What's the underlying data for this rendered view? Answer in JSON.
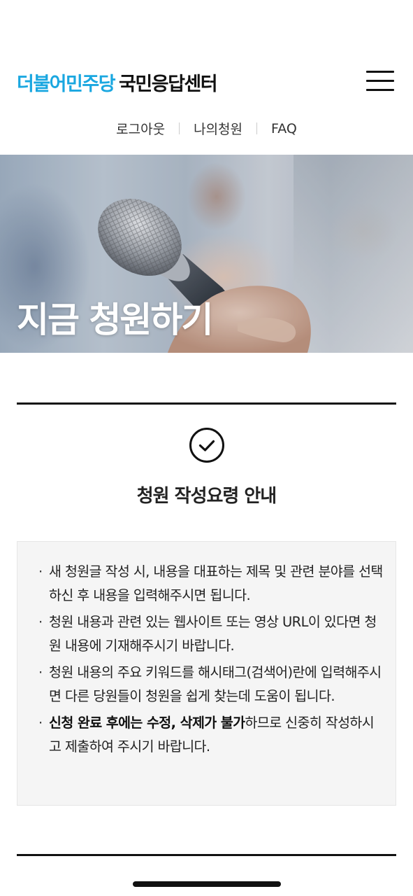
{
  "header": {
    "logo_party": "더불어민주당",
    "logo_center": "국민응답센터",
    "menu_icon": "hamburger-menu-icon"
  },
  "util_nav": {
    "logout": "로그아웃",
    "my_petitions": "나의청원",
    "faq": "FAQ"
  },
  "hero": {
    "title": "지금 청원하기",
    "image": "microphone-photo"
  },
  "guide": {
    "icon": "check-circle-icon",
    "title": "청원 작성요령 안내",
    "items": [
      {
        "text": "새 청원글 작성 시, 내용을 대표하는 제목 및 관련 분야를 선택하신 후 내용을 입력해주시면 됩니다."
      },
      {
        "text": "청원 내용과 관련 있는 웹사이트 또는 영상 URL이 있다면 청원 내용에 기재해주시기 바랍니다."
      },
      {
        "text": "청원 내용의 주요 키워드를 해시태그(검색어)란에 입력해주시면 다른 당원들이 청원을 쉽게 찾는데 도움이 됩니다."
      },
      {
        "bold": "신청 완료 후에는 수정, 삭제가 불가",
        "text": "하므로 신중히 작성하시고 제출하여 주시기 바랍니다."
      }
    ]
  },
  "colors": {
    "brand_blue": "#1aa7e0",
    "text_dark": "#111111",
    "box_bg": "#f5f5f5"
  }
}
